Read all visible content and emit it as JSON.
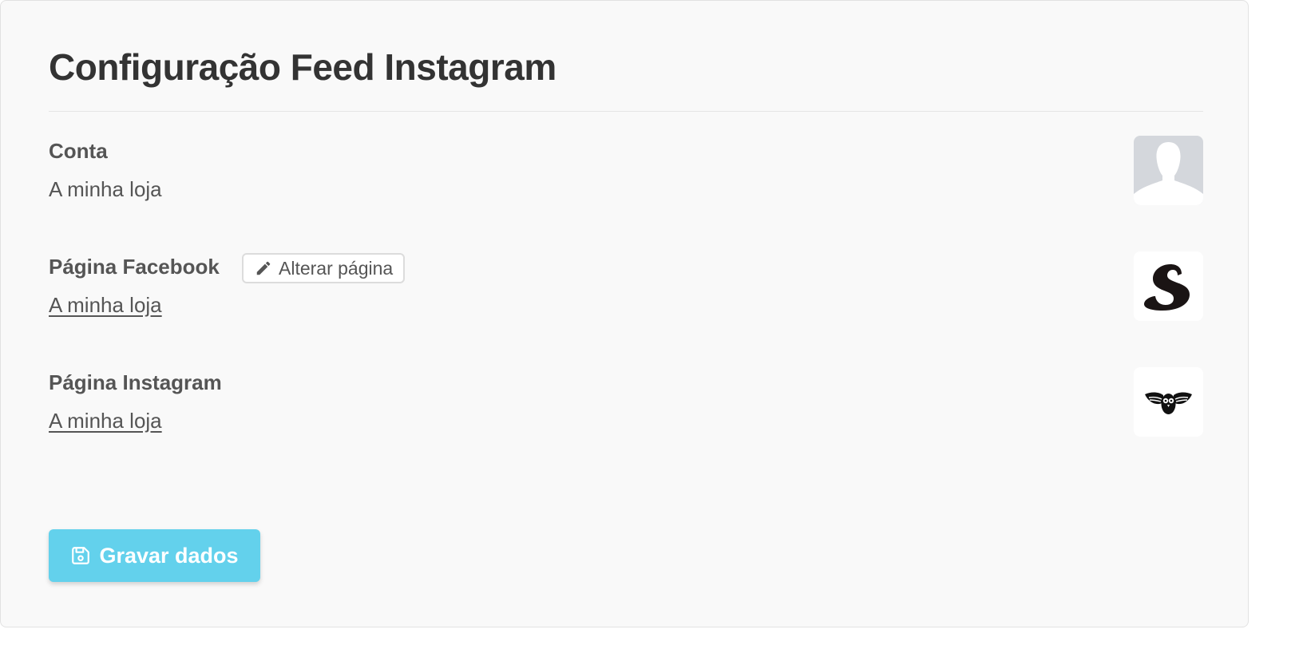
{
  "page": {
    "title": "Configuração Feed Instagram"
  },
  "account": {
    "label": "Conta",
    "value": "A minha loja",
    "avatar_icon": "default-user-avatar-icon"
  },
  "facebook": {
    "label": "Página Facebook",
    "edit_label": "Alterar página",
    "edit_icon": "pencil-icon",
    "value": "A minha loja",
    "logo_icon": "script-s-logo-icon"
  },
  "instagram": {
    "label": "Página Instagram",
    "value": "A minha loja",
    "logo_icon": "owl-logo-icon"
  },
  "actions": {
    "save_label": "Gravar dados",
    "save_icon": "floppy-disk-icon"
  },
  "colors": {
    "primary_button": "#63d1ec",
    "text": "#555555",
    "title": "#333333",
    "card_bg": "#f9f9f9"
  }
}
